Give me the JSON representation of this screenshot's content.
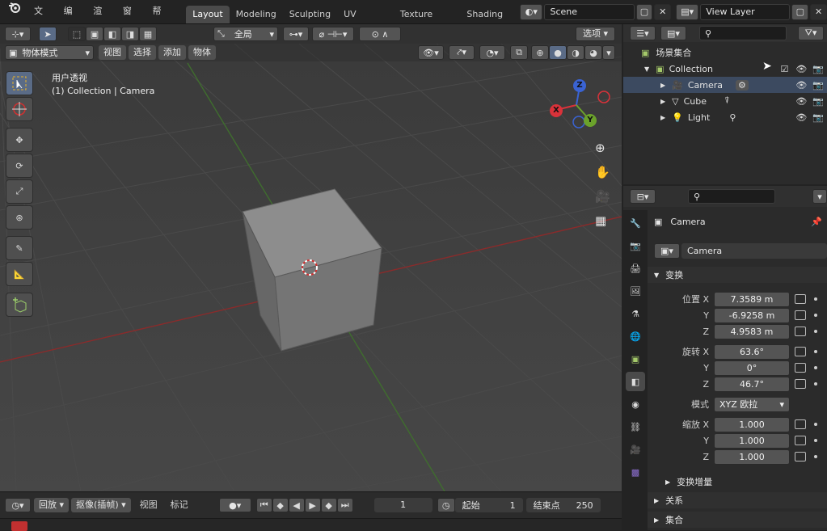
{
  "menubar": {
    "menus": [
      "文件",
      "编辑",
      "渲染",
      "窗口",
      "帮助"
    ],
    "workspaces": [
      "Layout",
      "Modeling",
      "Sculpting",
      "UV Editing",
      "Texture Paint",
      "Shading"
    ],
    "active_workspace": "Layout",
    "scene": "Scene",
    "view_layer": "View Layer"
  },
  "viewport": {
    "transform_orientation": "全局",
    "options_label": "选项",
    "mode": "物体模式",
    "menus": [
      "视图",
      "选择",
      "添加",
      "物体"
    ],
    "overlay_title": "用户透视",
    "overlay_subtitle": "(1) Collection | Camera",
    "gizmo": {
      "x": "X",
      "y": "Y",
      "z": "Z"
    }
  },
  "timeline": {
    "menus": [
      "回放",
      "抠像(插帧)",
      "视图",
      "标记"
    ],
    "current_frame": "1",
    "start_label": "起始",
    "start_value": "1",
    "end_label": "结束点",
    "end_value": "250"
  },
  "outliner": {
    "scene_collection": "场景集合",
    "items": [
      {
        "name": "Collection"
      },
      {
        "name": "Camera"
      },
      {
        "name": "Cube"
      },
      {
        "name": "Light"
      }
    ]
  },
  "properties": {
    "object_name": "Camera",
    "object_field": "Camera",
    "transform_header": "变换",
    "location_label": "位置 X",
    "location": {
      "x": "7.3589 m",
      "y": "-6.9258 m",
      "z": "4.9583 m"
    },
    "rotation_label": "旋转 X",
    "rotation": {
      "x": "63.6°",
      "y": "0°",
      "z": "46.7°"
    },
    "mode_label": "模式",
    "mode_value": "XYZ 欧拉",
    "scale_label": "缩放 X",
    "scale": {
      "x": "1.000",
      "y": "1.000",
      "z": "1.000"
    },
    "y_label": "Y",
    "z_label": "Z",
    "delta_transform": "变换增量",
    "relations": "关系",
    "collections": "集合"
  },
  "colors": {
    "accent": "#4772b3",
    "active_tab": "#4a4a4a",
    "x_axis": "#d9323a",
    "y_axis": "#6ba22b",
    "z_axis": "#3a63d3"
  }
}
